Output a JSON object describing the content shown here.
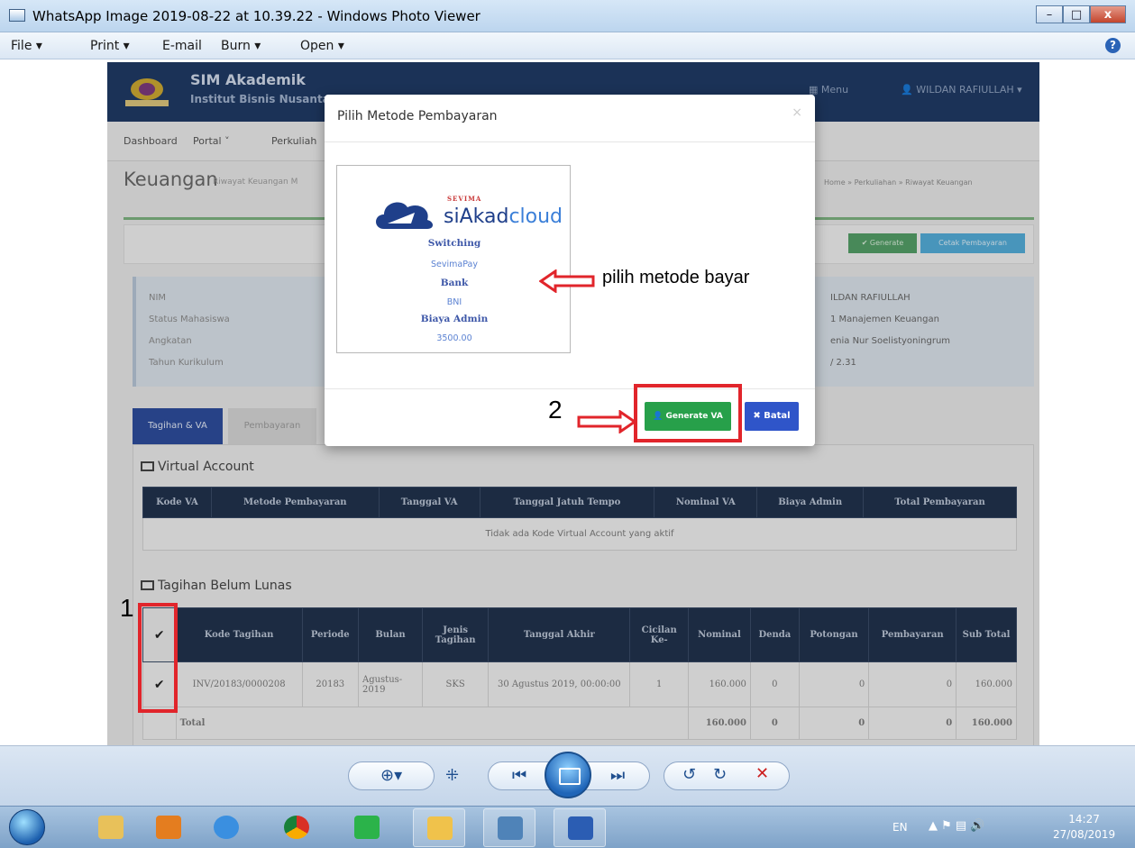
{
  "window": {
    "title": "WhatsApp Image 2019-08-22 at 10.39.22 - Windows Photo Viewer",
    "min": "–",
    "max": "□",
    "close": "x"
  },
  "menu": {
    "items": [
      "File ▾",
      "Print ▾",
      "E-mail",
      "Burn ▾",
      "Open ▾"
    ],
    "help": "?"
  },
  "app": {
    "brand_title": "SIM Akademik",
    "brand_sub": "Institut Bisnis Nusantara",
    "header_menu": "Menu",
    "header_user": "WILDAN RAFIULLAH ▾",
    "nav": [
      "Dashboard",
      "Portal ˅",
      "Perkuliah"
    ],
    "page_title": "Keuangan",
    "page_sub": "Riwayat Keuangan M",
    "breadcrumb": "Home » Perkuliahan » Riwayat Keuangan",
    "btn_generate": "✔ Generate",
    "btn_cetak": "Cetak Pembayaran",
    "info_labels": [
      "NIM",
      "Status Mahasiswa",
      "Angkatan",
      "Tahun Kurikulum"
    ],
    "info_values": [
      "ILDAN RAFIULLAH",
      "1 Manajemen Keuangan",
      "enia Nur Soelistyoningrum",
      "/ 2.31"
    ],
    "tab_active": "Tagihan & VA",
    "tab_idle": "Pembayaran",
    "va_section": "Virtual Account",
    "va_headers": [
      "Kode VA",
      "Metode Pembayaran",
      "Tanggal VA",
      "Tanggal Jatuh Tempo",
      "Nominal VA",
      "Biaya Admin",
      "Total Pembayaran"
    ],
    "va_empty": "Tidak ada Kode Virtual Account yang aktif",
    "tagihan_section": "Tagihan Belum Lunas",
    "tagihan_headers": [
      "✔",
      "Kode Tagihan",
      "Periode",
      "Bulan",
      "Jenis Tagihan",
      "Tanggal Akhir",
      "Cicilan Ke-",
      "Nominal",
      "Denda",
      "Potongan",
      "Pembayaran",
      "Sub Total"
    ],
    "tagihan_row": [
      "✔",
      "INV/20183/0000208",
      "20183",
      "Agustus-2019",
      "SKS",
      "30 Agustus 2019, 00:00:00",
      "1",
      "160.000",
      "0",
      "0",
      "0",
      "160.000"
    ],
    "total_label": "Total",
    "total_values": [
      "160.000",
      "0",
      "0",
      "0",
      "160.000"
    ]
  },
  "modal": {
    "title": "Pilih Metode Pembayaran",
    "close": "×",
    "card": {
      "brand_top": "SEVIMA",
      "brand_main_bold": "siAkad",
      "brand_main_light": "cloud",
      "lines": [
        "Switching",
        "SevimaPay",
        "Bank",
        "BNI",
        "Biaya Admin",
        "3500.00"
      ]
    },
    "btn_generate_va": "Generate VA",
    "btn_batal": "✖ Batal"
  },
  "annotations": {
    "arrow_text": "pilih metode bayar",
    "step1": "1",
    "step2": "2",
    "color": "#e1252b"
  },
  "taskbar": {
    "lang": "EN",
    "time": "14:27",
    "date": "27/08/2019"
  }
}
